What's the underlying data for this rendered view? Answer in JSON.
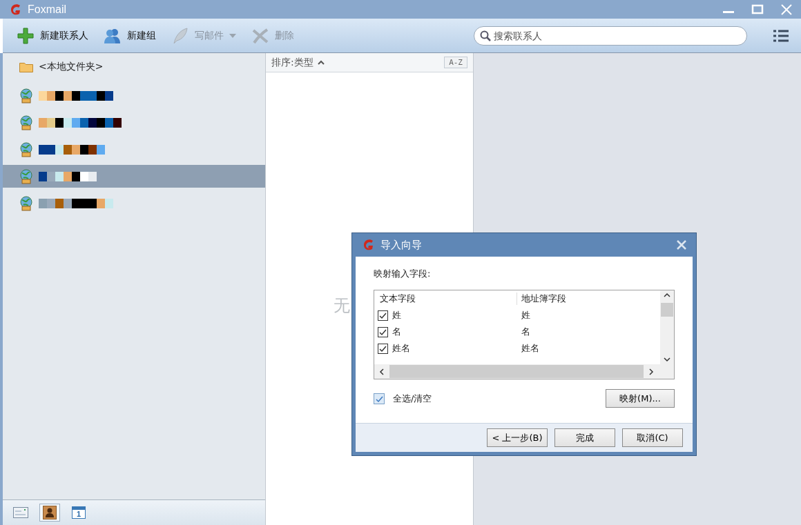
{
  "window": {
    "title": "Foxmail"
  },
  "toolbar": {
    "buttons": [
      {
        "label": "新建联系人",
        "disabled": false,
        "kind": "add",
        "dropdown": false
      },
      {
        "label": "新建组",
        "disabled": false,
        "kind": "group",
        "dropdown": false
      },
      {
        "label": "写邮件",
        "disabled": true,
        "kind": "compose",
        "dropdown": true
      },
      {
        "label": "删除",
        "disabled": true,
        "kind": "delete",
        "dropdown": false
      }
    ],
    "search": {
      "placeholder": "搜索联系人"
    }
  },
  "sidebar": {
    "folder": "<本地文件夹>",
    "accounts": [
      {
        "selected": false
      },
      {
        "selected": false
      },
      {
        "selected": false
      },
      {
        "selected": true
      },
      {
        "selected": false
      }
    ],
    "nav": [
      {
        "kind": "mail",
        "selected": false
      },
      {
        "kind": "contacts",
        "selected": true
      },
      {
        "kind": "calendar",
        "selected": false,
        "label": "1"
      }
    ]
  },
  "list": {
    "sort_label": "排序:类型",
    "sort_button": "A-Z",
    "empty_text": "无"
  },
  "dialog": {
    "title": "导入向导",
    "prompt": "映射输入字段:",
    "columns": [
      "文本字段",
      "地址簿字段"
    ],
    "rows": [
      {
        "text_field": "姓",
        "book_field": "姓",
        "checked": true
      },
      {
        "text_field": "名",
        "book_field": "名",
        "checked": true
      },
      {
        "text_field": "姓名",
        "book_field": "姓名",
        "checked": true
      }
    ],
    "select_all": {
      "label": "全选/清空",
      "checked": true
    },
    "map_button": "映射(M)...",
    "buttons": [
      "< 上一步(B)",
      "完成",
      "取消(C)"
    ]
  }
}
